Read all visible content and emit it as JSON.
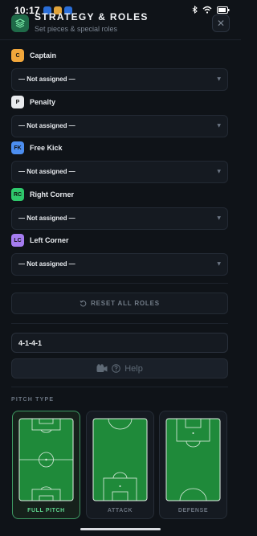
{
  "status": {
    "time": "10:17"
  },
  "header": {
    "title": "STRATEGY & ROLES",
    "subtitle": "Set pieces & special roles",
    "close_glyph": "✕"
  },
  "roles": [
    {
      "badge": "C",
      "label": "Captain",
      "color": "#f2a73b",
      "value": "— Not assigned —"
    },
    {
      "badge": "P",
      "label": "Penalty",
      "color": "#e9ebee",
      "value": "— Not assigned —"
    },
    {
      "badge": "FK",
      "label": "Free Kick",
      "color": "#4c8ef0",
      "value": "— Not assigned —"
    },
    {
      "badge": "RC",
      "label": "Right Corner",
      "color": "#2fc86c",
      "value": "— Not assigned —"
    },
    {
      "badge": "LC",
      "label": "Left Corner",
      "color": "#a57cf0",
      "value": "— Not assigned —"
    }
  ],
  "reset": {
    "label": "RESET ALL ROLES",
    "icon": "reset-icon"
  },
  "formation": {
    "value": "4-1-4-1"
  },
  "help": {
    "label": "Help",
    "icons": [
      "camera-icon",
      "question-icon"
    ]
  },
  "pitch_type": {
    "title": "PITCH TYPE",
    "options": [
      {
        "label": "FULL PITCH",
        "selected": true
      },
      {
        "label": "ATTACK",
        "selected": false
      },
      {
        "label": "DEFENSE",
        "selected": false
      }
    ]
  },
  "colors": {
    "accent": "#5ed48d",
    "pitch": "#1f8a3a",
    "background": "#0f1318"
  }
}
